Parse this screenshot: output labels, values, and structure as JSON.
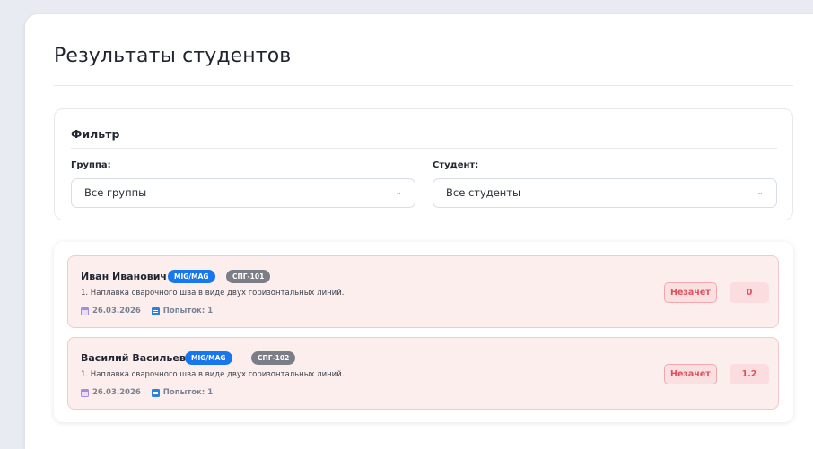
{
  "page": {
    "title": "Результаты студентов"
  },
  "filter": {
    "title": "Фильтр",
    "group": {
      "label": "Группа:",
      "value": "Все группы"
    },
    "student": {
      "label": "Студент:",
      "value": "Все студенты"
    }
  },
  "results": [
    {
      "name": "Иван Иванович",
      "method_badge": "MIG/MAG",
      "group_badge": "СПГ-101",
      "task": "1. Наплавка сварочного шва в виде двух горизонтальных линий.",
      "date": "26.03.2026",
      "attempts": "Попыток: 1",
      "status": "Незачет",
      "score": "0"
    },
    {
      "name": "Василий Васильевич",
      "method_badge": "MIG/MAG",
      "group_badge": "СПГ-102",
      "task": "1. Наплавка сварочного шва в виде двух горизонтальных линий.",
      "date": "26.03.2026",
      "attempts": "Попыток: 1",
      "status": "Незачет",
      "score": "1.2"
    }
  ],
  "icons": {
    "chevron": "chevron-down-icon",
    "date": "calendar-icon",
    "attempts": "attempts-icon"
  },
  "colors": {
    "accent_blue": "#1677ee",
    "fail_red": "#e0505c",
    "row_bg": "#fdeeee"
  }
}
